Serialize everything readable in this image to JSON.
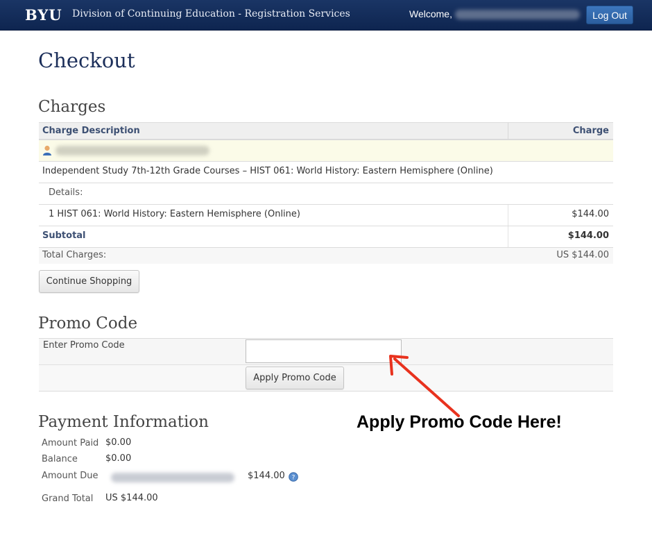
{
  "header": {
    "logo": "BYU",
    "title": "Division of Continuing Education - Registration Services",
    "welcome": "Welcome,",
    "logout_label": "Log Out"
  },
  "page_title": "Checkout",
  "charges": {
    "heading": "Charges",
    "columns": [
      "Charge Description",
      "Charge"
    ],
    "course_line": "Independent Study 7th-12th Grade Courses – HIST 061: World History: Eastern Hemisphere (Online)",
    "details_label": "Details:",
    "item_description": "1 HIST 061: World History: Eastern Hemisphere (Online)",
    "item_charge": "$144.00",
    "subtotal_label": "Subtotal",
    "subtotal_value": "$144.00",
    "total_label": "Total Charges:",
    "total_value": "US $144.00",
    "continue_label": "Continue Shopping"
  },
  "promo": {
    "heading": "Promo Code",
    "field_label": "Enter Promo Code",
    "input_value": "",
    "apply_label": "Apply Promo Code"
  },
  "annotation": {
    "text": "Apply Promo Code Here!",
    "arrow_color": "#e8321e"
  },
  "payment": {
    "heading": "Payment Information",
    "amount_paid_label": "Amount Paid",
    "amount_paid_value": "$0.00",
    "balance_label": "Balance",
    "balance_value": "$0.00",
    "amount_due_label": "Amount Due",
    "amount_due_value": "$144.00",
    "grand_total_label": "Grand Total",
    "grand_total_value": "US $144.00"
  },
  "colors": {
    "header_bg": "#0e2550",
    "title_blue": "#1c2f5a",
    "student_row_bg": "#fbfbe8"
  }
}
